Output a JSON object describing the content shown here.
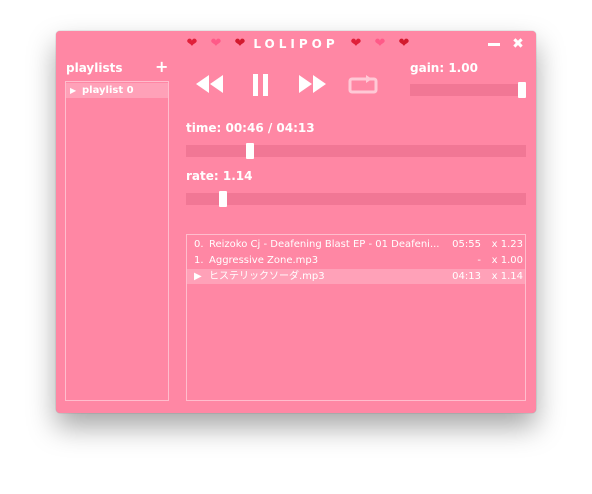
{
  "window": {
    "title": "LOLIPOP",
    "decor_left": [
      "❤",
      "❤",
      "❤"
    ],
    "decor_right": [
      "❤",
      "❤",
      "❤"
    ],
    "minimize_icon": "minimize-icon",
    "close_icon": "close-icon",
    "close_glyph": "✖"
  },
  "sidebar": {
    "header": "playlists",
    "add_glyph": "+",
    "items": [
      {
        "marker": "▶",
        "label": "playlist 0"
      }
    ]
  },
  "controls": {
    "icons": [
      "rewind-icon",
      "pause-icon",
      "fast-forward-icon",
      "repeat-icon"
    ]
  },
  "gain": {
    "label": "gain: 1.00",
    "value": 1.0
  },
  "time": {
    "label": "time: 00:46 / 04:13",
    "position_fraction": 0.18
  },
  "rate": {
    "label": "rate: 1.14",
    "position_fraction": 0.1
  },
  "files": [
    {
      "index": "0.",
      "name": "Reizoko Cj - Deafening Blast EP - 01 Deafeni...",
      "duration": "05:55",
      "rate": "x 1.23",
      "active": false
    },
    {
      "index": "1.",
      "name": "Aggressive Zone.mp3",
      "duration": "-",
      "rate": "x 1.00",
      "active": false
    },
    {
      "index": "▶",
      "name": "ヒステリックソーダ.mp3",
      "duration": "04:13",
      "rate": "x 1.14",
      "active": true
    }
  ],
  "colors": {
    "background": "#ff87a4",
    "text": "#ffffff",
    "heart_dark": "#d21a2e",
    "heart_light": "#ff5a88"
  }
}
